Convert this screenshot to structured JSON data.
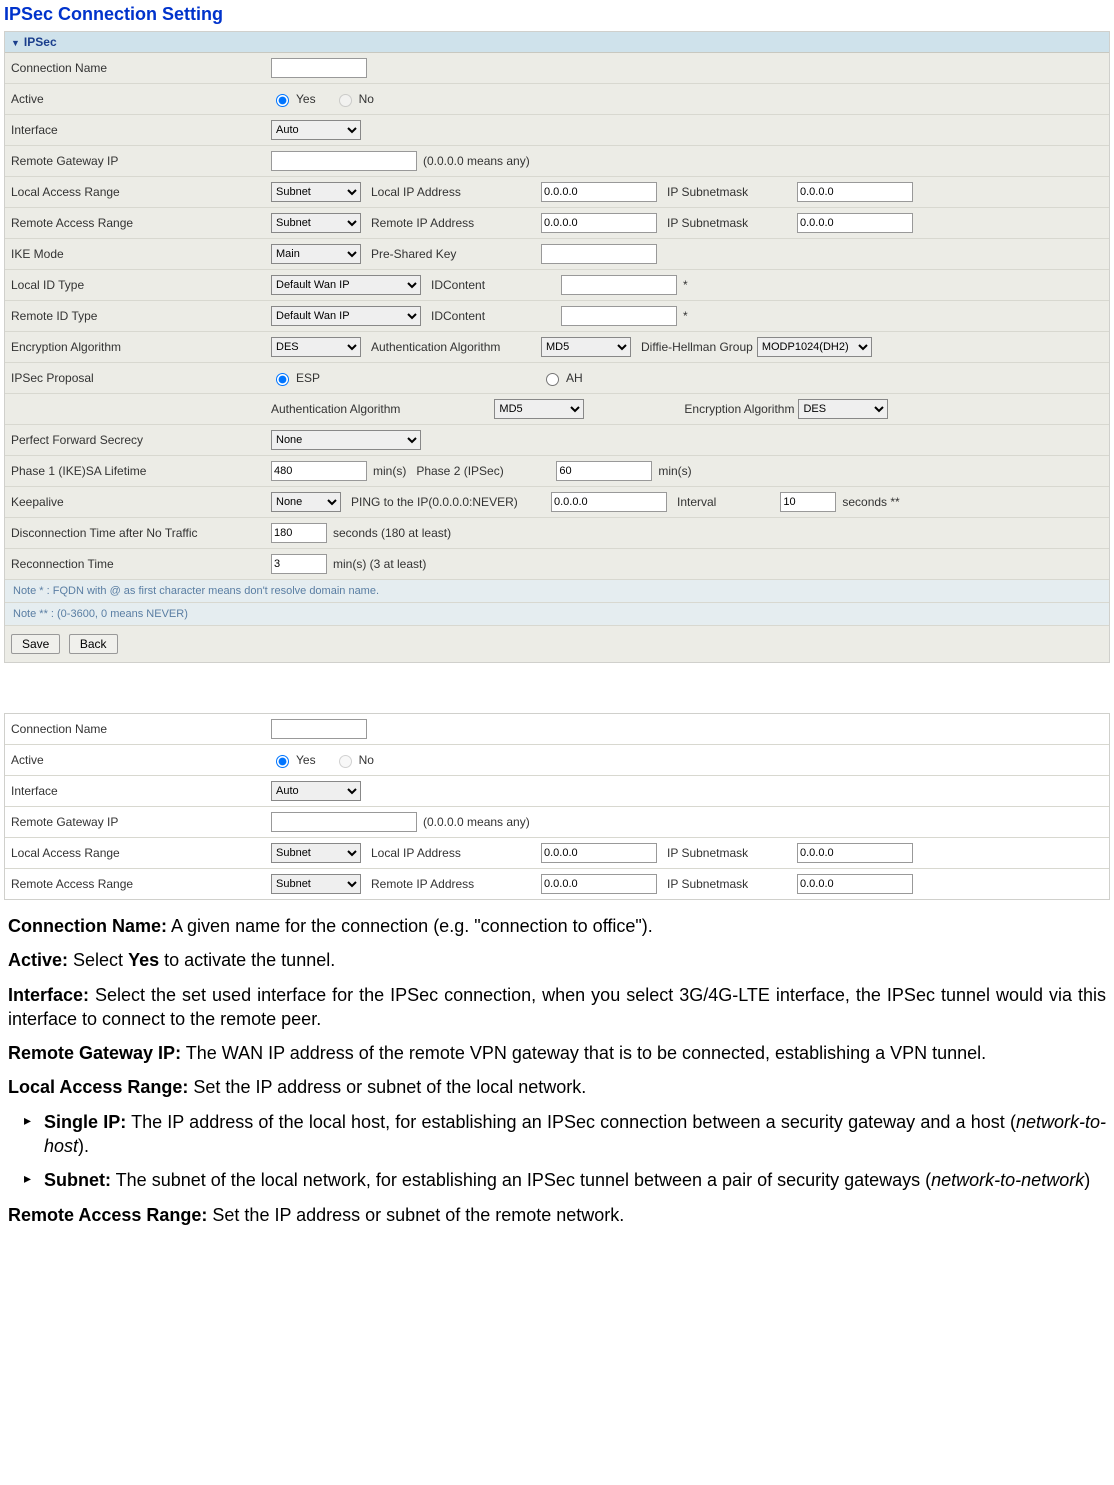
{
  "heading": "IPSec Connection Setting",
  "panel": {
    "title": "IPSec",
    "rows": {
      "connName": {
        "label": "Connection Name",
        "value": ""
      },
      "active": {
        "label": "Active",
        "yes": "Yes",
        "no": "No"
      },
      "interface": {
        "label": "Interface",
        "select": "Auto"
      },
      "remoteGw": {
        "label": "Remote Gateway IP",
        "value": "",
        "hint": "(0.0.0.0 means any)"
      },
      "localRange": {
        "label": "Local Access Range",
        "select": "Subnet",
        "l2": "Local IP Address",
        "ip": "0.0.0.0",
        "l3": "IP Subnetmask",
        "mask": "0.0.0.0"
      },
      "remoteRange": {
        "label": "Remote Access Range",
        "select": "Subnet",
        "l2": "Remote IP Address",
        "ip": "0.0.0.0",
        "l3": "IP Subnetmask",
        "mask": "0.0.0.0"
      },
      "ikeMode": {
        "label": "IKE Mode",
        "select": "Main",
        "l2": "Pre-Shared Key",
        "value": ""
      },
      "localId": {
        "label": "Local ID Type",
        "select": "Default Wan IP",
        "l2": "IDContent",
        "value": "",
        "suffix": "*"
      },
      "remoteId": {
        "label": "Remote ID Type",
        "select": "Default Wan IP",
        "l2": "IDContent",
        "value": "",
        "suffix": "*"
      },
      "encAlg": {
        "label": "Encryption Algorithm",
        "select": "DES",
        "l2": "Authentication Algorithm",
        "select2": "MD5",
        "l3": "Diffie-Hellman Group",
        "select3": "MODP1024(DH2)"
      },
      "proposal": {
        "label": "IPSec Proposal",
        "esp": "ESP",
        "ah": "AH"
      },
      "propSub": {
        "l2": "Authentication Algorithm",
        "select2": "MD5",
        "l3": "Encryption Algorithm",
        "select3": "DES"
      },
      "pfs": {
        "label": "Perfect Forward Secrecy",
        "select": "None"
      },
      "phase1": {
        "label": "Phase 1 (IKE)SA Lifetime",
        "value": "480",
        "unit": "min(s)",
        "l2": "Phase 2 (IPSec)",
        "value2": "60",
        "unit2": "min(s)"
      },
      "keepalive": {
        "label": "Keepalive",
        "select": "None",
        "l2": "PING to the IP(0.0.0.0:NEVER)",
        "ip": "0.0.0.0",
        "l3": "Interval",
        "value3": "10",
        "unit3": "seconds **"
      },
      "disc": {
        "label": "Disconnection Time after No Traffic",
        "value": "180",
        "unit": "seconds (180 at least)"
      },
      "reconn": {
        "label": "Reconnection Time",
        "value": "3",
        "unit": "min(s) (3 at least)"
      }
    },
    "notes": {
      "note1": "Note * : FQDN with @ as first character means don't resolve domain name.",
      "note2": "Note ** : (0-3600, 0 means NEVER)"
    },
    "buttons": {
      "save": "Save",
      "back": "Back"
    }
  },
  "desc": {
    "p1a": "Connection Name:",
    "p1b": " A given name for the connection (e.g. \"connection to office\").",
    "p2a": "Active:",
    "p2b": " Select ",
    "p2c": "Yes",
    "p2d": " to activate the tunnel.",
    "p3a": "Interface:",
    "p3b": " Select the set used interface for the IPSec connection, when you select 3G/4G-LTE interface, the IPSec tunnel would via this interface to connect to the remote peer.",
    "p4a": "Remote Gateway IP:",
    "p4b": " The WAN IP address of the remote VPN gateway that is to be connected, establishing a VPN tunnel.",
    "p5a": "Local Access Range:",
    "p5b": " Set the IP address or subnet of the local network.",
    "li1a": "Single IP:",
    "li1b": " The IP address of the local host, for establishing an IPSec connection between a security gateway and a host (",
    "li1c": "network-to-host",
    "li1d": ").",
    "li2a": "Subnet:",
    "li2b": " The subnet of the local network, for establishing an IPSec tunnel between a pair of security gateways (",
    "li2c": "network-to-network",
    "li2d": ")",
    "p6a": "Remote Access Range:",
    "p6b": " Set the IP address or subnet of the remote network."
  }
}
